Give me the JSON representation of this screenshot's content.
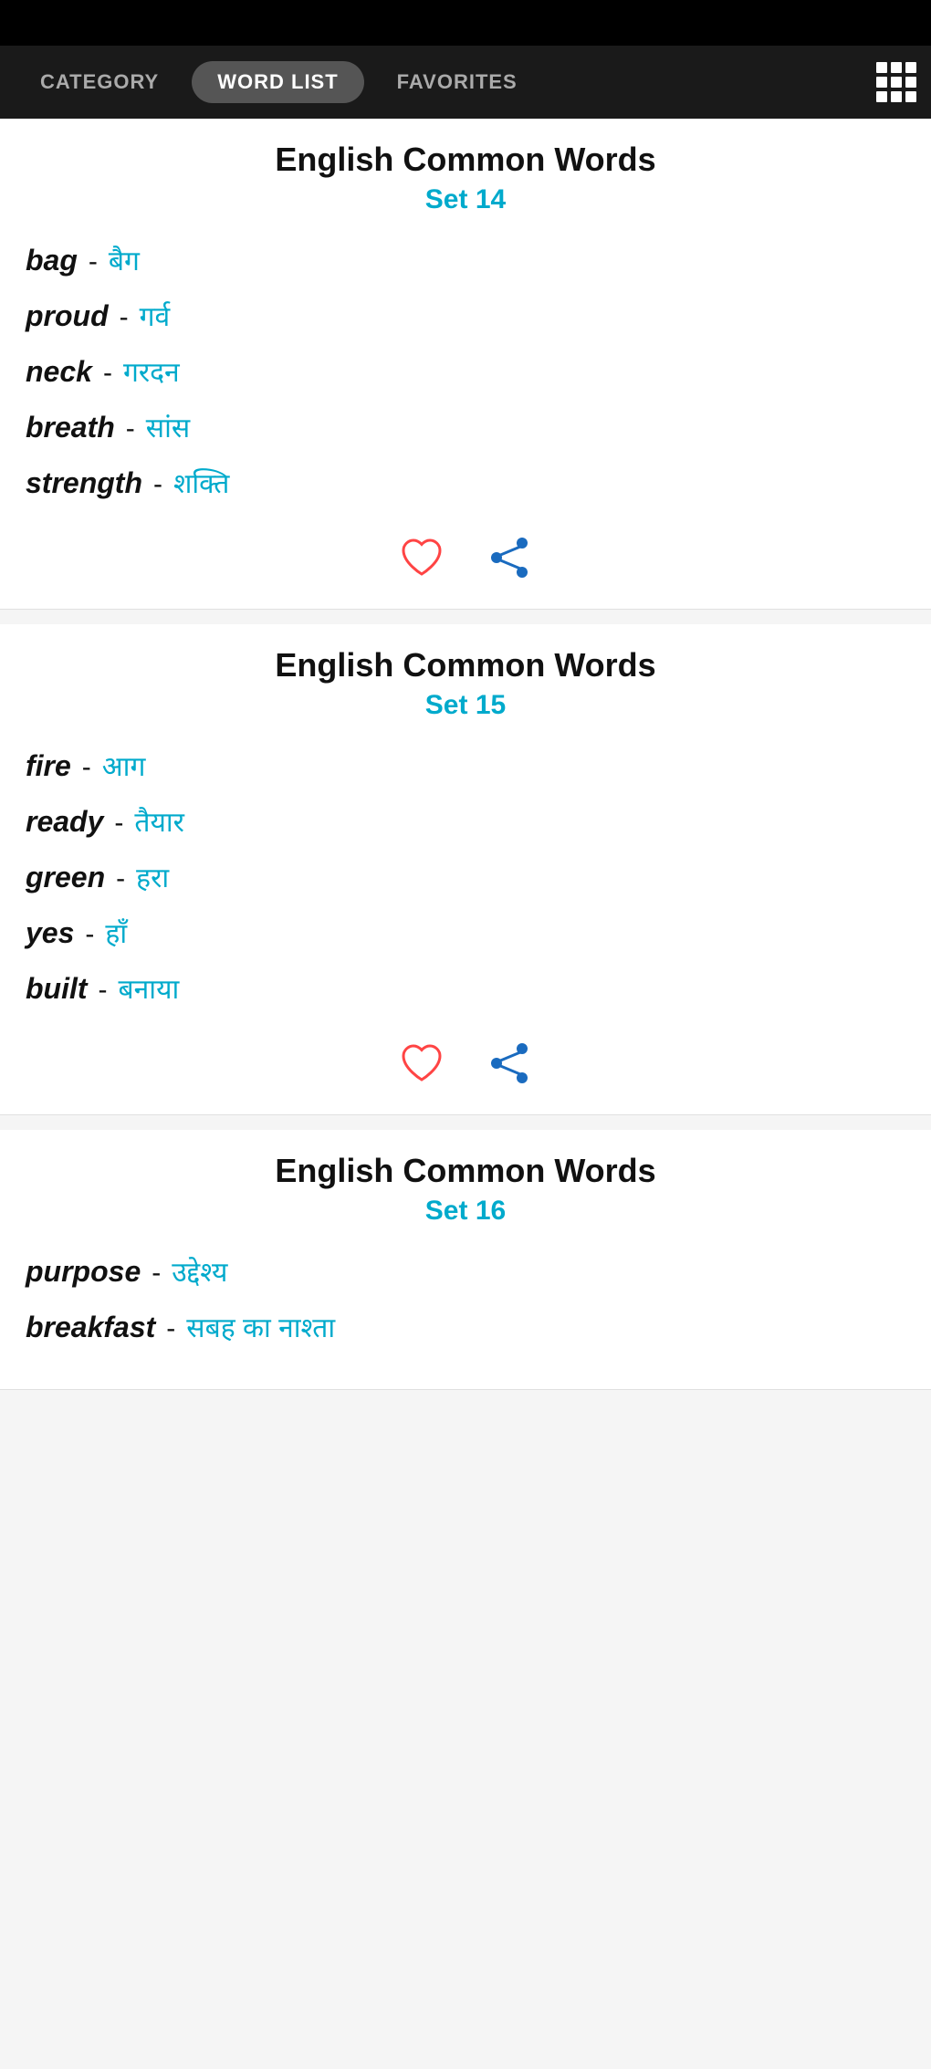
{
  "nav": {
    "tabs": [
      {
        "label": "CATEGORY",
        "active": false
      },
      {
        "label": "WORD LIST",
        "active": true
      },
      {
        "label": "FAVORITES",
        "active": false
      }
    ],
    "grid_icon_label": "grid-view"
  },
  "sets": [
    {
      "title": "English Common Words",
      "subtitle": "Set 14",
      "words": [
        {
          "english": "bag",
          "dash": "-",
          "hindi": "बैग"
        },
        {
          "english": "proud",
          "dash": "-",
          "hindi": "गर्व"
        },
        {
          "english": "neck",
          "dash": "-",
          "hindi": "गरदन"
        },
        {
          "english": "breath",
          "dash": "-",
          "hindi": "सांस"
        },
        {
          "english": "strength",
          "dash": "-",
          "hindi": "शक्ति"
        }
      ]
    },
    {
      "title": "English Common Words",
      "subtitle": "Set 15",
      "words": [
        {
          "english": "fire",
          "dash": "-",
          "hindi": "आग"
        },
        {
          "english": "ready",
          "dash": "-",
          "hindi": "तैयार"
        },
        {
          "english": "green",
          "dash": "-",
          "hindi": "हरा"
        },
        {
          "english": "yes",
          "dash": "-",
          "hindi": "हाँ"
        },
        {
          "english": "built",
          "dash": "-",
          "hindi": "बनाया"
        }
      ]
    },
    {
      "title": "English Common Words",
      "subtitle": "Set 16",
      "words": [
        {
          "english": "purpose",
          "dash": "-",
          "hindi": "उद्देश्य"
        },
        {
          "english": "breakfast",
          "dash": "-",
          "hindi": "सबह का नाश्ता"
        }
      ]
    }
  ],
  "colors": {
    "accent": "#00aacc",
    "heart": "#ff4444",
    "share": "#1a6bbf",
    "nav_active_bg": "#555555"
  }
}
